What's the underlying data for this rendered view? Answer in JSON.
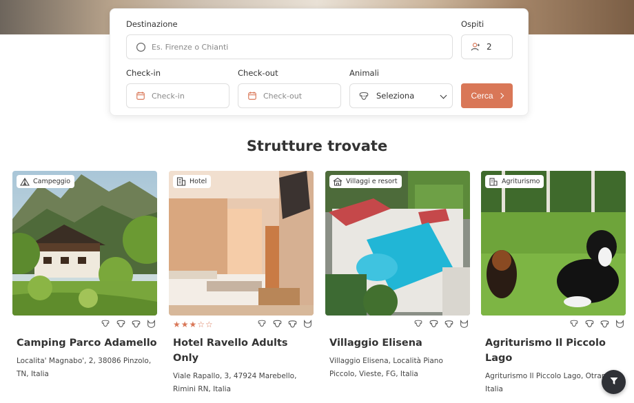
{
  "search": {
    "destination_label": "Destinazione",
    "destination_placeholder": "Es. Firenze o Chianti",
    "guests_label": "Ospiti",
    "guests_value": "2",
    "checkin_label": "Check-in",
    "checkin_placeholder": "Check-in",
    "checkout_label": "Check-out",
    "checkout_placeholder": "Check-out",
    "animals_label": "Animali",
    "animals_value": "Seleziona",
    "search_button": "Cerca",
    "accent_color": "#d97757"
  },
  "results": {
    "title": "Strutture trovate",
    "cards": [
      {
        "category": "Campeggio",
        "category_icon": "tent-icon",
        "name": "Camping Parco Adamello",
        "address": "Localita' Magnabo', 2, 38086 Pinzolo, TN, Italia",
        "stars": null
      },
      {
        "category": "Hotel",
        "category_icon": "hotel-icon",
        "name": "Hotel Ravello Adults Only",
        "address": "Viale Rapallo, 3, 47924 Marebello, Rimini RN, Italia",
        "stars": "★★★☆☆"
      },
      {
        "category": "Villaggi e resort",
        "category_icon": "resort-icon",
        "name": "Villaggio Elisena",
        "address": "Villaggio Elisena, Località Piano Piccolo, Vieste, FG, Italia",
        "stars": null
      },
      {
        "category": "Agriturismo",
        "category_icon": "farmhouse-icon",
        "name": "Agriturismo Il Piccolo Lago",
        "address": "Agriturismo Il Piccolo Lago, Otrant LE, Italia",
        "stars": null
      }
    ],
    "pet_icons": [
      "small-dog-icon",
      "medium-dog-icon",
      "large-dog-icon",
      "cat-icon"
    ]
  },
  "fab": {
    "icon": "filter-icon"
  }
}
